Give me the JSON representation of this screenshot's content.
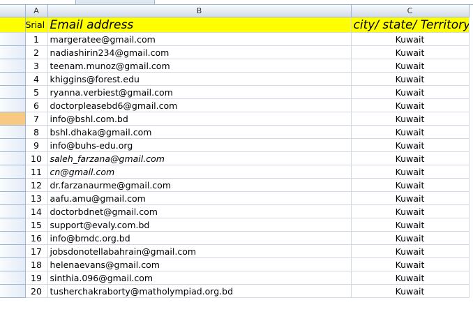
{
  "columns": [
    "A",
    "B",
    "C"
  ],
  "header_row": {
    "serial": "Srial no",
    "email": "Email address",
    "location": "city/ state/ Territory"
  },
  "rows": [
    {
      "serial": "1",
      "email": "margeratee@gmail.com",
      "location": "Kuwait",
      "italic": false
    },
    {
      "serial": "2",
      "email": "nadiashirin234@gmail.com",
      "location": "Kuwait",
      "italic": false
    },
    {
      "serial": "3",
      "email": "teenam.munoz@gmail.com",
      "location": "Kuwait",
      "italic": false
    },
    {
      "serial": "4",
      "email": "khiggins@forest.edu",
      "location": "Kuwait",
      "italic": false
    },
    {
      "serial": "5",
      "email": "ryanna.verbiest@gmail.com",
      "location": "Kuwait",
      "italic": false
    },
    {
      "serial": "6",
      "email": "doctorpleasebd6@gmail.com",
      "location": "Kuwait",
      "italic": false
    },
    {
      "serial": "7",
      "email": "info@bshl.com.bd",
      "location": "Kuwait",
      "italic": false
    },
    {
      "serial": "8",
      "email": "bshl.dhaka@gmail.com",
      "location": "Kuwait",
      "italic": false
    },
    {
      "serial": "9",
      "email": "info@buhs-edu.org",
      "location": "Kuwait",
      "italic": false
    },
    {
      "serial": "10",
      "email": "saleh_farzana@gmail.com",
      "location": "Kuwait",
      "italic": true
    },
    {
      "serial": "11",
      "email": "cn@gmail.com",
      "location": "Kuwait",
      "italic": true
    },
    {
      "serial": "12",
      "email": "dr.farzanaurme@gmail.com",
      "location": "Kuwait",
      "italic": false
    },
    {
      "serial": "13",
      "email": "aafu.amu@gmail.com",
      "location": "Kuwait",
      "italic": false
    },
    {
      "serial": "14",
      "email": "doctorbdnet@gmail.com",
      "location": "Kuwait",
      "italic": false
    },
    {
      "serial": "15",
      "email": "support@evaly.com.bd",
      "location": "Kuwait",
      "italic": false
    },
    {
      "serial": "16",
      "email": "info@bmdc.org.bd",
      "location": "Kuwait",
      "italic": false
    },
    {
      "serial": "17",
      "email": "jobsdonotellabahrain@gmail.com",
      "location": "Kuwait",
      "italic": false
    },
    {
      "serial": "18",
      "email": "helenaevans@gmail.com",
      "location": "Kuwait",
      "italic": false
    },
    {
      "serial": "19",
      "email": "sinthia.096@gmail.com",
      "location": "Kuwait",
      "italic": false
    },
    {
      "serial": "20",
      "email": "tusherchakraborty@matholympiad.org.bd",
      "location": "Kuwait",
      "italic": false
    }
  ],
  "colors": {
    "header_fill": "#ffff00",
    "gridline": "#d0d7e5",
    "heading_border": "#9eb6ce",
    "selected_row_header": "#f8c983"
  }
}
